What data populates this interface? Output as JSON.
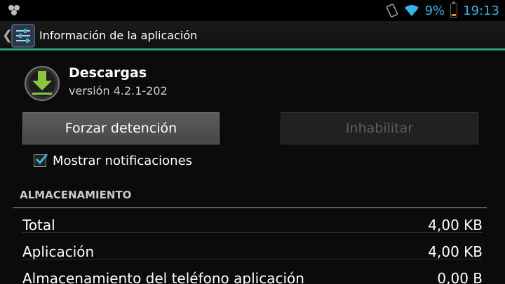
{
  "status_bar": {
    "left_icon": "notification-app-icon",
    "icons": [
      "vibrate-icon",
      "wifi-icon"
    ],
    "battery_percent": "9%",
    "time": "19:13",
    "colors": {
      "accent": "#33b5e5",
      "battery_low": "#ff8800"
    }
  },
  "action_bar": {
    "up_icon": "chevron-left-icon",
    "app_icon": "settings-sliders-icon",
    "title": "Información de la aplicación",
    "divider_color": "#2e9e7a"
  },
  "app": {
    "icon": "download-arrow-icon",
    "name": "Descargas",
    "version": "versión 4.2.1-202"
  },
  "buttons": {
    "force_stop": "Forzar detención",
    "disable": "Inhabilitar"
  },
  "notifications": {
    "label": "Mostrar notificaciones",
    "checked": true,
    "check_color": "#33b5e5"
  },
  "storage": {
    "header": "ALMACENAMIENTO",
    "rows": [
      {
        "label": "Total",
        "value": "4,00 KB"
      },
      {
        "label": "Aplicación",
        "value": "4,00 KB"
      },
      {
        "label": "Almacenamiento del teléfono aplicación",
        "value": "0,00 B"
      }
    ]
  }
}
